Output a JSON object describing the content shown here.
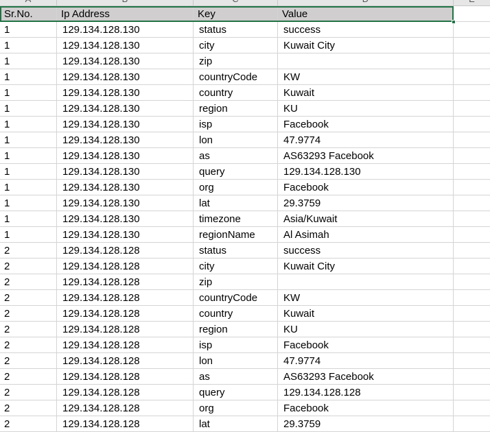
{
  "column_letters": [
    "A",
    "B",
    "C",
    "D",
    "E"
  ],
  "headers": [
    "Sr.No.",
    "Ip Address",
    "Key",
    "Value"
  ],
  "rows": [
    [
      "1",
      "129.134.128.130",
      "status",
      "success"
    ],
    [
      "1",
      "129.134.128.130",
      "city",
      "Kuwait City"
    ],
    [
      "1",
      "129.134.128.130",
      "zip",
      ""
    ],
    [
      "1",
      "129.134.128.130",
      "countryCode",
      "KW"
    ],
    [
      "1",
      "129.134.128.130",
      "country",
      "Kuwait"
    ],
    [
      "1",
      "129.134.128.130",
      "region",
      "KU"
    ],
    [
      "1",
      "129.134.128.130",
      "isp",
      "Facebook"
    ],
    [
      "1",
      "129.134.128.130",
      "lon",
      "47.9774"
    ],
    [
      "1",
      "129.134.128.130",
      "as",
      "AS63293 Facebook"
    ],
    [
      "1",
      "129.134.128.130",
      "query",
      "129.134.128.130"
    ],
    [
      "1",
      "129.134.128.130",
      "org",
      "Facebook"
    ],
    [
      "1",
      "129.134.128.130",
      "lat",
      "29.3759"
    ],
    [
      "1",
      "129.134.128.130",
      "timezone",
      "Asia/Kuwait"
    ],
    [
      "1",
      "129.134.128.130",
      "regionName",
      "Al Asimah"
    ],
    [
      "2",
      "129.134.128.128",
      "status",
      "success"
    ],
    [
      "2",
      "129.134.128.128",
      "city",
      "Kuwait City"
    ],
    [
      "2",
      "129.134.128.128",
      "zip",
      ""
    ],
    [
      "2",
      "129.134.128.128",
      "countryCode",
      "KW"
    ],
    [
      "2",
      "129.134.128.128",
      "country",
      "Kuwait"
    ],
    [
      "2",
      "129.134.128.128",
      "region",
      "KU"
    ],
    [
      "2",
      "129.134.128.128",
      "isp",
      "Facebook"
    ],
    [
      "2",
      "129.134.128.128",
      "lon",
      "47.9774"
    ],
    [
      "2",
      "129.134.128.128",
      "as",
      "AS63293 Facebook"
    ],
    [
      "2",
      "129.134.128.128",
      "query",
      "129.134.128.128"
    ],
    [
      "2",
      "129.134.128.128",
      "org",
      "Facebook"
    ],
    [
      "2",
      "129.134.128.128",
      "lat",
      "29.3759"
    ]
  ],
  "colors": {
    "header_fill": "#d0cece",
    "gridline": "#d4d4d4",
    "selection": "#217346"
  }
}
